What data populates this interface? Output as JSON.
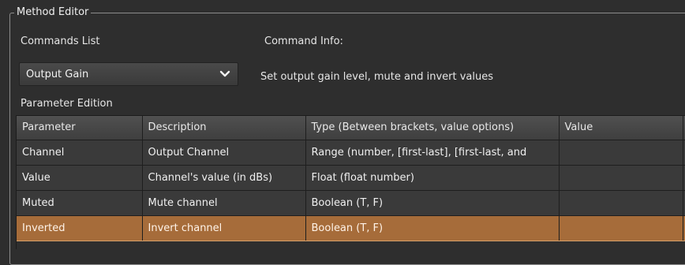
{
  "group_title": "Method Editor",
  "commands_list_label": "Commands List",
  "command_info_label": "Command Info:",
  "selected_command": "Output Gain",
  "command_info_text": "Set output gain level, mute and invert values",
  "parameter_edition_label": "Parameter Edition",
  "table": {
    "columns": [
      "Parameter",
      "Description",
      "Type (Between brackets, value options)",
      "Value"
    ],
    "rows": [
      {
        "parameter": "Channel",
        "description": "Output Channel",
        "type": "Range (number, [first-last], [first-last, and",
        "value": ""
      },
      {
        "parameter": "Value",
        "description": "Channel's value (in dBs)",
        "type": "Float (float number)",
        "value": ""
      },
      {
        "parameter": "Muted",
        "description": "Mute channel",
        "type": "Boolean (T, F)",
        "value": ""
      },
      {
        "parameter": "Inverted",
        "description": "Invert channel",
        "type": "Boolean (T, F)",
        "value": ""
      }
    ],
    "selected_row_index": 3
  },
  "colors": {
    "background": "#2e2e2e",
    "selected_row": "#a66c3a",
    "header": "#4a4a4a"
  },
  "icons": {
    "dropdown": "chevron-down-icon"
  }
}
